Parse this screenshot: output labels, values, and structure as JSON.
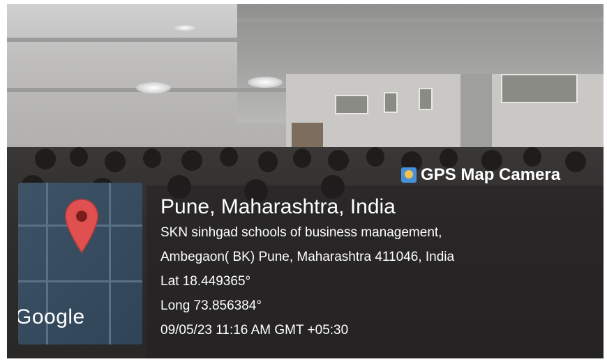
{
  "brand": {
    "label": "GPS Map Camera",
    "icon": "app-icon"
  },
  "map": {
    "provider_label": "Google",
    "pin_color": "#e05050"
  },
  "location": {
    "city": "Pune, Maharashtra, India",
    "address_line1": "SKN sinhgad schools of business management,",
    "address_line2": "Ambegaon( BK) Pune, Maharashtra 411046, India",
    "lat": "Lat 18.449365°",
    "long": "Long 73.856384°",
    "datetime": "09/05/23 11:16 AM GMT +05:30"
  }
}
